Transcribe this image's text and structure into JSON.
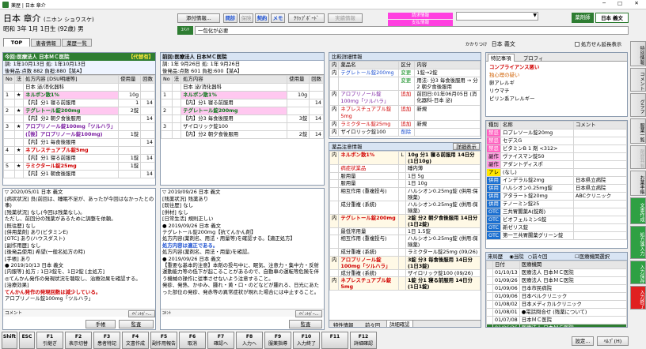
{
  "window": {
    "title": "薬歴 | 日本 章介"
  },
  "patient": {
    "name": "日本 章介",
    "kana": "(ニホン ショウスケ)",
    "dob": "昭和 3年 1月 1日生 (92歳) 男"
  },
  "topbar": {
    "attach": "添付情報...",
    "q_label": "問診",
    "chk_label": "保険",
    "contract_label": "契約",
    "memo_label": "メモ",
    "clip_label": "ｸﾘｯﾌﾟﾎﾞｰﾄﾞ",
    "reg_label": "実績情報",
    "alert1": "請求情報",
    "alert2": "支払情報",
    "dropdown": "",
    "pharmacist_label": "薬剤師",
    "pharmacist_name": "日本 義文",
    "comment_label": "ｺﾒﾝﾄ",
    "comment_value": "一包化が必要"
  },
  "tabs": [
    "TOP",
    "患者情報",
    "薬歴一覧"
  ],
  "handler": {
    "label": "かかりつけ",
    "name": "日本 義文",
    "checkbox": "処方せん延長表示"
  },
  "rx_current": {
    "title": "今回:医療法人 日本ＭＣ医院",
    "badge": "【代替有】",
    "line1": "調: 1年10月13日 処: 1年10月13日",
    "line2": "後発品:点数 882 負担:880【某A】",
    "headers": [
      "No",
      "法",
      "処方内容 [DSU明細等]",
      "使用量",
      "回数"
    ],
    "rows": [
      {
        "no": "",
        "flag": "",
        "text": "日本 泌/消化器科",
        "qty": "",
        "cnt": "",
        "cls": "hdrrow"
      },
      {
        "no": "1",
        "flag": "★",
        "text": "ネルボン散1%",
        "qty": "10g",
        "cnt": "",
        "cls": "pink"
      },
      {
        "no": "",
        "flag": "",
        "text": "【内】分1 寝る前服用",
        "qty": "1",
        "cnt": "14",
        "cls": ""
      },
      {
        "no": "2",
        "flag": "★",
        "text": "テグレトール錠200mg",
        "qty": "2錠",
        "cnt": "",
        "cls": "pinkg"
      },
      {
        "no": "",
        "flag": "",
        "text": "【内】分2 朝夕食後服用",
        "qty": "",
        "cnt": "14",
        "cls": ""
      },
      {
        "no": "3",
        "flag": "★",
        "text": "アロプリノール錠100mg「ツルハラ」",
        "qty": "",
        "cnt": "",
        "cls": "purple"
      },
      {
        "no": "",
        "flag": "",
        "text": "(【後】アロプリノール錠100mg)",
        "qty": "1錠",
        "cnt": "",
        "cls": "purple"
      },
      {
        "no": "",
        "flag": "",
        "text": "【内】分1 毎食後服用",
        "qty": "",
        "cnt": "14",
        "cls": ""
      },
      {
        "no": "4",
        "flag": "★",
        "text": "ネプレスチュアブル錠5mg",
        "qty": "",
        "cnt": "",
        "cls": "red"
      },
      {
        "no": "",
        "flag": "",
        "text": "【内】分1 寝る前服用",
        "qty": "1錠",
        "cnt": "14",
        "cls": ""
      },
      {
        "no": "5",
        "flag": "★",
        "text": "ラミクタール錠25mg",
        "qty": "1錠",
        "cnt": "",
        "cls": "red"
      },
      {
        "no": "",
        "flag": "",
        "text": "【内】分1 朝食後服用",
        "qty": "",
        "cnt": "14",
        "cls": ""
      }
    ]
  },
  "rx_prev": {
    "title": "前回:医療法人 日本ＭＣ医院",
    "line1": "調: 1年 9月26日 処: 1年 9月26日",
    "line2": "後発品:点数 601 負担:600【某A】",
    "headers": [
      "No",
      "法",
      "処方内容",
      "使用量",
      "回数"
    ],
    "rows": [
      {
        "no": "",
        "flag": "",
        "text": "日本 泌/消化器科",
        "qty": "",
        "cnt": "",
        "cls": ""
      },
      {
        "no": "1",
        "flag": "",
        "text": "ネルボン散1%",
        "qty": "10g",
        "cnt": "",
        "cls": "pink"
      },
      {
        "no": "",
        "flag": "",
        "text": "【内】分1 寝る前服用",
        "qty": "",
        "cnt": "14",
        "cls": ""
      },
      {
        "no": "2",
        "flag": "",
        "text": "テグレトール錠200mg",
        "qty": "",
        "cnt": "",
        "cls": "pink"
      },
      {
        "no": "",
        "flag": "",
        "text": "【内】分3 毎食後服用",
        "qty": "3錠",
        "cnt": "14",
        "cls": ""
      },
      {
        "no": "3",
        "flag": "",
        "text": "ザイロリック錠100",
        "qty": "",
        "cnt": "",
        "cls": ""
      },
      {
        "no": "",
        "flag": "",
        "text": "【内】分2 朝夕食後服用",
        "qty": "2錠",
        "cnt": "14",
        "cls": ""
      }
    ]
  },
  "compare": {
    "title": "比較詳細情報",
    "headers": [
      "内",
      "薬品名",
      "区分",
      "内容"
    ],
    "rows": [
      {
        "k": "内",
        "name": "テグレトール錠200mg",
        "kubun": "変更",
        "content": "1錠→2錠",
        "cls": "blue"
      },
      {
        "k": "",
        "name": "",
        "kubun": "変更",
        "content": "用法: 分3 毎食後服用 → 分2 朝夕食後服用",
        "cls": "blue"
      },
      {
        "k": "内",
        "name": "アロプリノール錠100mg「ツルハラ」",
        "kubun": "追加",
        "content": "前回日:01年06月05日 (消化器科-日本 泌)",
        "cls": "purple"
      },
      {
        "k": "内",
        "name": "ネプレスチュアブル錠5mg",
        "kubun": "追加",
        "content": "新規",
        "cls": "red"
      },
      {
        "k": "内",
        "name": "ラミクタール錠25mg",
        "kubun": "追加",
        "content": "新規",
        "cls": "red"
      },
      {
        "k": "内",
        "name": "ザイロリック錠100",
        "kubun": "削除",
        "content": "",
        "cls": ""
      }
    ]
  },
  "caution": {
    "title": "薬品注意情報",
    "detail_btn": "詳細表示",
    "rows": [
      {
        "a": "内",
        "b": "ネルボン散1%",
        "c": "L",
        "d": "10g 分1 寝る前服用 14日分 (1日10g)",
        "cls": "red"
      },
      {
        "a": "",
        "b": "病症状業品",
        "c": "",
        "d": "睡内薄",
        "cls": "pinkt"
      },
      {
        "a": "",
        "b": "服用量",
        "c": "",
        "d": "1日 5g",
        "cls": ""
      },
      {
        "a": "",
        "b": "服用量",
        "c": "",
        "d": "1日 10g",
        "cls": ""
      },
      {
        "a": "",
        "b": "相互作用 (重複投与)",
        "c": "",
        "d": "ハルシオン0.25mg錠 (併用:保険薬)",
        "cls": ""
      },
      {
        "a": "",
        "b": "成分重複 (系統)",
        "c": "",
        "d": "ハルシオン0.25mg錠 (併用:保険薬)",
        "cls": ""
      },
      {
        "a": "内",
        "b": "テグレトール錠200mg",
        "c": "",
        "d": "2錠 分2 朝夕食後服用 14日分 (1日2錠)",
        "cls": "red"
      },
      {
        "a": "",
        "b": "最低常用量",
        "c": "",
        "d": "1日 1.5錠",
        "cls": ""
      },
      {
        "a": "",
        "b": "相互作用 (重複投与)",
        "c": "",
        "d": "ハルシオン0.25mg錠 (併用:保険薬)",
        "cls": ""
      },
      {
        "a": "",
        "b": "成分重複 (系統)",
        "c": "",
        "d": "ラミクタール錠25mg (09/26)",
        "cls": ""
      },
      {
        "a": "内",
        "b": "アロプリノール錠100mg「ツルハラ」",
        "c": "",
        "d": "3錠 分3 毎食後服用 14日分 (1日3錠)",
        "cls": "red"
      },
      {
        "a": "",
        "b": "成分重複 (系統)",
        "c": "",
        "d": "ザイロリック錠100 (09/26)",
        "cls": ""
      },
      {
        "a": "内",
        "b": "ネプレスチュアブル錠5mg",
        "c": "",
        "d": "1錠 分1 寝る前服用 14日分 (1日1錠)",
        "cls": "red"
      }
    ],
    "tabs": [
      "特性情報",
      "前々回",
      "詳細確認"
    ]
  },
  "special": {
    "tabs": [
      "特記事項",
      "プロフィ"
    ],
    "lines": [
      {
        "t": "コンプライアンス悪い",
        "cls": "red b"
      },
      {
        "t": "独心理の疑い",
        "cls": "orange"
      },
      {
        "t": "卵アレルギ",
        "cls": ""
      },
      {
        "t": "リウマチ",
        "cls": ""
      },
      {
        "t": "ピリン系アレルギー",
        "cls": ""
      }
    ]
  },
  "druglist": {
    "headers": [
      "種別",
      "名称",
      "コメント"
    ],
    "rows": [
      {
        "kind": "禁忌",
        "name": "ロプレソール錠20mg",
        "comment": "",
        "kcls": "pink"
      },
      {
        "kind": "禁忌",
        "name": "セデスG",
        "comment": "",
        "kcls": "pink"
      },
      {
        "kind": "禁忌",
        "name": "ビタミンB 1 剤 <312>",
        "comment": "",
        "kcls": "pink"
      },
      {
        "kind": "副作",
        "name": "ヴァイスマン錠50",
        "comment": "",
        "kcls": "pink2"
      },
      {
        "kind": "副作",
        "name": "アダントディスポ",
        "comment": "",
        "kcls": "pink2"
      },
      {
        "kind": "アレ",
        "name": "(なし)",
        "comment": "",
        "kcls": "yellow"
      },
      {
        "kind": "併用",
        "name": "インデラル錠2mg",
        "comment": "日本県立病院",
        "kcls": "blue"
      },
      {
        "kind": "併用",
        "name": "ハルシオン0.25mg錠",
        "comment": "日本県立病院",
        "kcls": "blue"
      },
      {
        "kind": "併用",
        "name": "アタラート錠20mg",
        "comment": "ABCクリニック",
        "kcls": "blue"
      },
      {
        "kind": "併用",
        "name": "テノーミン錠25",
        "comment": "",
        "kcls": "blue"
      },
      {
        "kind": "OTC",
        "name": "三共胃腸薬A(錠剤)",
        "comment": "",
        "kcls": "blue"
      },
      {
        "kind": "OTC",
        "name": "ビオフェルミンS錠",
        "comment": "",
        "kcls": "blue"
      },
      {
        "kind": "OTC",
        "name": "新ゼリス錠",
        "comment": "",
        "kcls": "blue"
      },
      {
        "kind": "OTC",
        "name": "第一三共胃腸薬グリーン錠",
        "comment": "",
        "kcls": "blue"
      }
    ]
  },
  "visits": {
    "title": "来局歴",
    "options": [
      "当院",
      "前々回"
    ],
    "checkbox": "医療機関選択",
    "headers": [
      "日付",
      "医療機関"
    ],
    "rows": [
      {
        "d": "01/10/13",
        "c": "医療法人 日本ＭＣ医院",
        "sel": false
      },
      {
        "d": "01/09/26",
        "c": "医療法人 日本ＭＣ医院",
        "sel": false
      },
      {
        "d": "01/09/06",
        "c": "日本市民病院",
        "sel": false
      },
      {
        "d": "01/09/06",
        "c": "日本ベルクリニック",
        "sel": false
      },
      {
        "d": "01/08/02",
        "c": "日本メディカルクリニック",
        "sel": false
      },
      {
        "d": "01/08/01",
        "c": "●電話問合せ (残薬について)",
        "sel": false
      },
      {
        "d": "01/07/08",
        "c": "日本ＭＣ医院",
        "sel": false
      },
      {
        "d": "01/06/26",
        "c": "医療法人 日本ＭＣ医院",
        "sel": true
      },
      {
        "d": "01/10/10",
        "c": "医療法人 日本ＭＣ医院",
        "sel": false
      }
    ]
  },
  "history_now": {
    "header": "▽ 2020/05/01 日本 義文",
    "lines": [
      {
        "t": "[病状状況] 良(前回は、睡眠不足が、あったが今回はなかったとの事)",
        "cls": ""
      },
      {
        "t": "[残薬状況] なし(今回は残薬なし)。",
        "cls": ""
      },
      {
        "t": "ただし、前回分の残薬があるために調整を依頼。",
        "cls": ""
      },
      {
        "t": "[既往歴]    なし",
        "cls": ""
      },
      {
        "t": "[併用薬剤] あり(ビタミンE)",
        "cls": ""
      },
      {
        "t": "[OTC]      あり(ハウスダスト)",
        "cls": ""
      },
      {
        "t": "[副作用歴] なし",
        "cls": ""
      },
      {
        "t": "[後発品使用] 希望(一般名処方の時)",
        "cls": ""
      },
      {
        "t": "[手帳]    あり",
        "cls": ""
      },
      {
        "t": "● 2019/10/13 日本 義文",
        "cls": ""
      },
      {
        "t": "[内服等] 処方 ; 1日3錠を、1日2錠 [主処方]",
        "cls": ""
      },
      {
        "t": "◎てんかん発作の発現状況を聴取し、治療効果を確認する。",
        "cls": ""
      },
      {
        "t": "[治療効果]",
        "cls": ""
      },
      {
        "t": "てんかん発作の発現回数は減少している。",
        "cls": "red b"
      },
      {
        "t": "アロプリノール錠100mg「ツルハラ」",
        "cls": ""
      }
    ],
    "comment_label": "コメント",
    "comment_value": "",
    "btn_techo": "手帳",
    "btn_audit": "監査"
  },
  "history_prev": {
    "header": "▽ 2019/09/26 日本 義文",
    "lines": [
      {
        "t": "[残薬状況] 残薬あり",
        "cls": ""
      },
      {
        "t": "[既往歴]    なし",
        "cls": ""
      },
      {
        "t": "[併材]     なし",
        "cls": ""
      },
      {
        "t": "[日常生活] 規則正しい",
        "cls": ""
      },
      {
        "t": "● 2019/09/26 日本 義文",
        "cls": ""
      },
      {
        "t": "テグレトール錠200mg【抗てんかん剤】",
        "cls": ""
      },
      {
        "t": "処方内容(薬剤名、用法・用量等)を確認する。【適正処方】",
        "cls": ""
      },
      {
        "t": "処方内容は適正である。",
        "cls": "blue b"
      },
      {
        "t": "処方内容(薬剤名、用法・用量)を確認。",
        "cls": ""
      },
      {
        "t": "● 2019/09/26 日本 義文",
        "cls": ""
      },
      {
        "t": "【重要な基本的注意】本剤の投与中に、眠気、注意力・集中力・反射運動能力等の低下が起こることがあるので、自動車の運転等危険を伴う機械の操作に従事させないよう注意すること。",
        "cls": "mixed"
      },
      {
        "t": "発疹、発熱、かゆみ、腫れ・黄・口・のどなどが腫れる、日光にあたった部位の発疹、発赤等の異常症状が現れた場合には中止すること。",
        "cls": ""
      }
    ],
    "comment_label": "ｺﾒﾝﾄ",
    "comment_value": "",
    "btn_audit": "監査"
  },
  "ibe_btn": "ｲﾍﾞﾝﾄﾎﾞｰ...",
  "right_tabs": [
    "特別情報",
    "コメント",
    "グラフ",
    "服薬一覧",
    "剤歴共有",
    "お薬手帳",
    "文書作成",
    "処方箋入力",
    "入力保存",
    "入力終了"
  ],
  "fkeys": [
    {
      "k": "Shift",
      "l": ""
    },
    {
      "k": "ESC",
      "l": ""
    },
    {
      "k": "F1",
      "l": "引継ぎ"
    },
    {
      "k": "F2",
      "l": "表示切替"
    },
    {
      "k": "F3",
      "l": "患者特記"
    },
    {
      "k": "F4",
      "l": "文書作成"
    },
    {
      "k": "F5",
      "l": "副作用報告"
    },
    {
      "k": "F6",
      "l": "取消"
    },
    {
      "k": "F7",
      "l": "確認へ"
    },
    {
      "k": "F8",
      "l": "入力へ"
    },
    {
      "k": "F9",
      "l": "服薬指導"
    },
    {
      "k": "F10",
      "l": "入力終了"
    },
    {
      "k": "F11",
      "l": ""
    },
    {
      "k": "F12",
      "l": "詳細確認"
    }
  ],
  "footer": {
    "settings": "設定...",
    "help": "ﾍﾙﾌﾟ(H)"
  },
  "colors": {
    "accent": "#2e7d32",
    "header": "#d8e4f3",
    "red": "#d00000",
    "blue": "#1b4fd0",
    "pink": "#ffc8f0"
  }
}
